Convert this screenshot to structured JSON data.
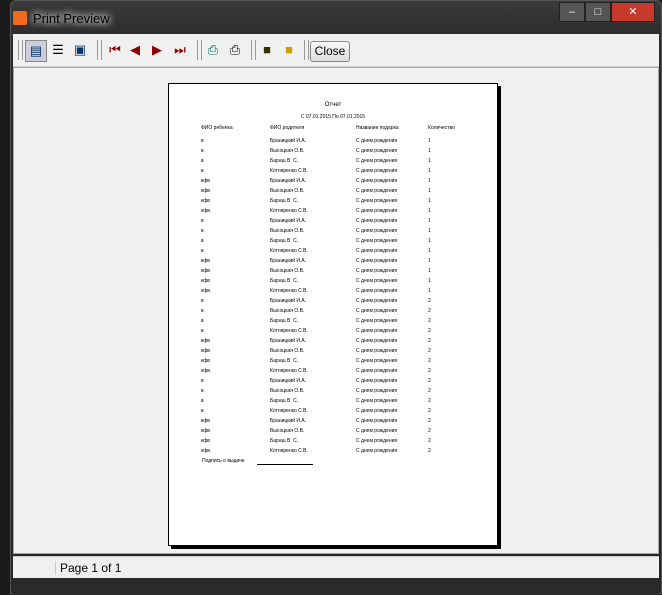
{
  "window": {
    "title": "Print Preview",
    "close_label": "Close"
  },
  "toolbar": {
    "icons": [
      "one-page-icon",
      "multi-page-icon",
      "page-width-icon",
      "first-page-icon",
      "prev-page-icon",
      "next-page-icon",
      "last-page-icon",
      "printer-setup-icon",
      "print-icon",
      "save-icon",
      "open-icon"
    ]
  },
  "report": {
    "title": "Отчет",
    "subtitle": "С 07.01.2015 По 07.01.2015",
    "headers": [
      "ФИО ребенка",
      "ФИО родителя",
      "Название подарка",
      "Количество"
    ],
    "rows": [
      [
        "в",
        "Браницкий И.А.",
        "С днем рождения",
        "1"
      ],
      [
        "в",
        "Высоцкая О.В.",
        "С днем рождения",
        "1"
      ],
      [
        "в",
        "Бараш В. С.",
        "С днем рождения",
        "1"
      ],
      [
        "в",
        "Котляренко С.В.",
        "С днем рождения",
        "1"
      ],
      [
        "кфв",
        "Браницкий И.А.",
        "С днем рождения",
        "1"
      ],
      [
        "кфв",
        "Высоцкая О.В.",
        "С днем рождения",
        "1"
      ],
      [
        "кфв",
        "Бараш В. С.",
        "С днем рождения",
        "1"
      ],
      [
        "кфв",
        "Котляренко С.В.",
        "С днем рождения",
        "1"
      ],
      [
        "в",
        "Браницкий И.А.",
        "С днем рождения",
        "1"
      ],
      [
        "в",
        "Высоцкая О.В.",
        "С днем рождения",
        "1"
      ],
      [
        "в",
        "Бараш В. С.",
        "С днем рождения",
        "1"
      ],
      [
        "в",
        "Котляренко С.В.",
        "С днем рождения",
        "1"
      ],
      [
        "кфв",
        "Браницкий И.А.",
        "С днем рождения",
        "1"
      ],
      [
        "кфв",
        "Высоцкая О.В.",
        "С днем рождения",
        "1"
      ],
      [
        "кфв",
        "Бараш В. С.",
        "С днем рождения",
        "1"
      ],
      [
        "кфв",
        "Котляренко С.В.",
        "С днем рождения",
        "1"
      ],
      [
        "в",
        "Браницкий И.А.",
        "С днем рождения",
        "2"
      ],
      [
        "в",
        "Высоцкая О.В.",
        "С днем рождения",
        "2"
      ],
      [
        "в",
        "Бараш В. С.",
        "С днем рождения",
        "2"
      ],
      [
        "в",
        "Котляренко С.В.",
        "С днем рождения",
        "2"
      ],
      [
        "кфв",
        "Браницкий И.А.",
        "С днем рождения",
        "2"
      ],
      [
        "кфв",
        "Высоцкая О.В.",
        "С днем рождения",
        "2"
      ],
      [
        "кфв",
        "Бараш В. С.",
        "С днем рождения",
        "2"
      ],
      [
        "кфв",
        "Котляренко С.В.",
        "С днем рождения",
        "2"
      ],
      [
        "в",
        "Браницкий И.А.",
        "С днем рождения",
        "2"
      ],
      [
        "в",
        "Высоцкая О.В.",
        "С днем рождения",
        "2"
      ],
      [
        "в",
        "Бараш В. С.",
        "С днем рождения",
        "2"
      ],
      [
        "в",
        "Котляренко С.В.",
        "С днем рождения",
        "2"
      ],
      [
        "кфв",
        "Браницкий И.А.",
        "С днем рождения",
        "2"
      ],
      [
        "кфв",
        "Высоцкая О.В.",
        "С днем рождения",
        "2"
      ],
      [
        "кфв",
        "Бараш В. С.",
        "С днем рождения",
        "2"
      ],
      [
        "кфв",
        "Котляренко С.В.",
        "С днем рождения",
        "2"
      ]
    ],
    "signature_label": "Подпись о выдаче"
  },
  "status": {
    "page": "Page 1 of 1"
  }
}
